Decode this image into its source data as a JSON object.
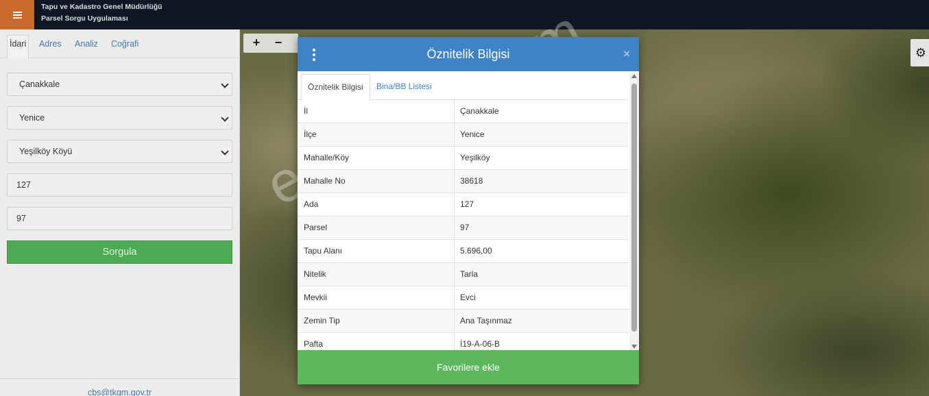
{
  "header": {
    "title_line1": "Tapu ve Kadastro Genel Müdürlüğü",
    "title_line2": "Parsel Sorgu Uygulaması",
    "menu_icon": "hamburger-icon"
  },
  "left_panel": {
    "tabs": [
      {
        "label": "İdari",
        "active": true
      },
      {
        "label": "Adres",
        "active": false
      },
      {
        "label": "Analiz",
        "active": false
      },
      {
        "label": "Coğrafi",
        "active": false
      }
    ],
    "il": "Çanakkale",
    "ilce": "Yenice",
    "mahalle": "Yeşilköy Köyü",
    "ada": "127",
    "parsel": "97",
    "submit_label": "Sorgula",
    "footer_email": "cbs@tkgm.gov.tr"
  },
  "map": {
    "zoom_in": "+",
    "zoom_out": "−",
    "watermark": "emlakjet.com"
  },
  "modal": {
    "title": "Öznitelik Bilgisi",
    "close": "×",
    "tabs": [
      {
        "label": "Öznitelik Bilgisi",
        "active": true
      },
      {
        "label": "Bina/BB Listesi",
        "active": false
      }
    ],
    "rows": [
      {
        "key": "İl",
        "value": "Çanakkale"
      },
      {
        "key": "İlçe",
        "value": "Yenice"
      },
      {
        "key": "Mahalle/Köy",
        "value": "Yeşilköy"
      },
      {
        "key": "Mahalle No",
        "value": "38618"
      },
      {
        "key": "Ada",
        "value": "127"
      },
      {
        "key": "Parsel",
        "value": "97"
      },
      {
        "key": "Tapu Alanı",
        "value": "5.696,00"
      },
      {
        "key": "Nitelik",
        "value": "Tarla"
      },
      {
        "key": "Mevkii",
        "value": "Evci"
      },
      {
        "key": "Zemin Tip",
        "value": "Ana Taşınmaz"
      },
      {
        "key": "Pafta",
        "value": "İ19-A-06-B"
      }
    ],
    "favorite_label": "Favorilere ekle"
  },
  "colors": {
    "header_bg": "#0e1722",
    "menu_accent": "#c9692c",
    "modal_header": "#3d83c5",
    "submit_green": "#4caa52",
    "favorite_green": "#5cb85c",
    "link_blue": "#3f79b1"
  }
}
